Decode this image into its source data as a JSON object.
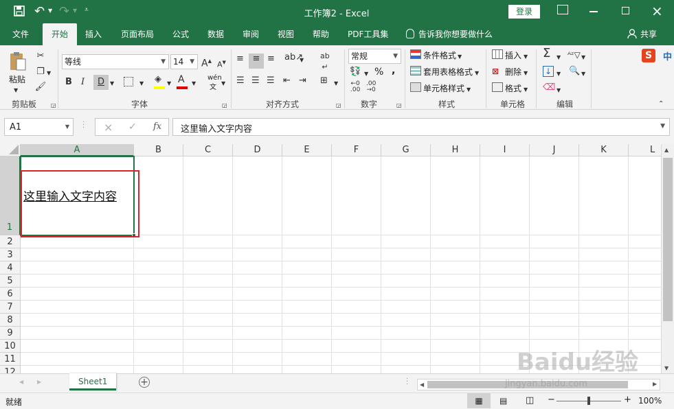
{
  "app": {
    "window_title": "工作簿2 - Excel",
    "login_label": "登录",
    "accent_color": "#217346"
  },
  "quick_access": {
    "save_icon": "save-icon",
    "undo_icon": "undo-icon",
    "redo_icon": "redo-icon",
    "customize_icon": "customize-icon"
  },
  "tabs": [
    {
      "label": "文件"
    },
    {
      "label": "开始"
    },
    {
      "label": "插入"
    },
    {
      "label": "页面布局"
    },
    {
      "label": "公式"
    },
    {
      "label": "数据"
    },
    {
      "label": "审阅"
    },
    {
      "label": "视图"
    },
    {
      "label": "帮助"
    },
    {
      "label": "PDF工具集"
    },
    {
      "label": "告诉我你想要做什么"
    }
  ],
  "share_label": "共享",
  "ribbon": {
    "clipboard": {
      "paste_label": "粘贴",
      "group_label": "剪贴板"
    },
    "font": {
      "font_name": "等线",
      "font_size": "14",
      "group_label": "字体",
      "phonetic_label": "wén",
      "phonetic_sub": "文"
    },
    "alignment": {
      "group_label": "对齐方式"
    },
    "number": {
      "format": "常规",
      "group_label": "数字",
      "percent": "%",
      "comma": ","
    },
    "styles": {
      "conditional": "条件格式",
      "table": "套用表格格式",
      "cell_styles": "单元格样式",
      "group_label": "样式"
    },
    "cells": {
      "insert": "插入",
      "delete": "删除",
      "format": "格式",
      "group_label": "单元格"
    },
    "editing": {
      "group_label": "编辑"
    },
    "ime_label": "中"
  },
  "formula_bar": {
    "name_box": "A1",
    "formula": "这里输入文字内容",
    "fx": "fx"
  },
  "grid": {
    "columns": [
      "A",
      "B",
      "C",
      "D",
      "E",
      "F",
      "G",
      "H",
      "I",
      "J",
      "K",
      "L"
    ],
    "rows": [
      "1",
      "2",
      "3",
      "4",
      "5",
      "6",
      "7",
      "8",
      "9",
      "10",
      "11",
      "12"
    ],
    "cell_a1": "这里输入文字内容",
    "highlight_color": "#d9232a"
  },
  "sheet_tabs": [
    "Sheet1"
  ],
  "status": {
    "ready": "就绪",
    "zoom": "100%"
  },
  "watermark": {
    "text": "Baidu经验",
    "sub": "jingyan.baidu.com"
  }
}
